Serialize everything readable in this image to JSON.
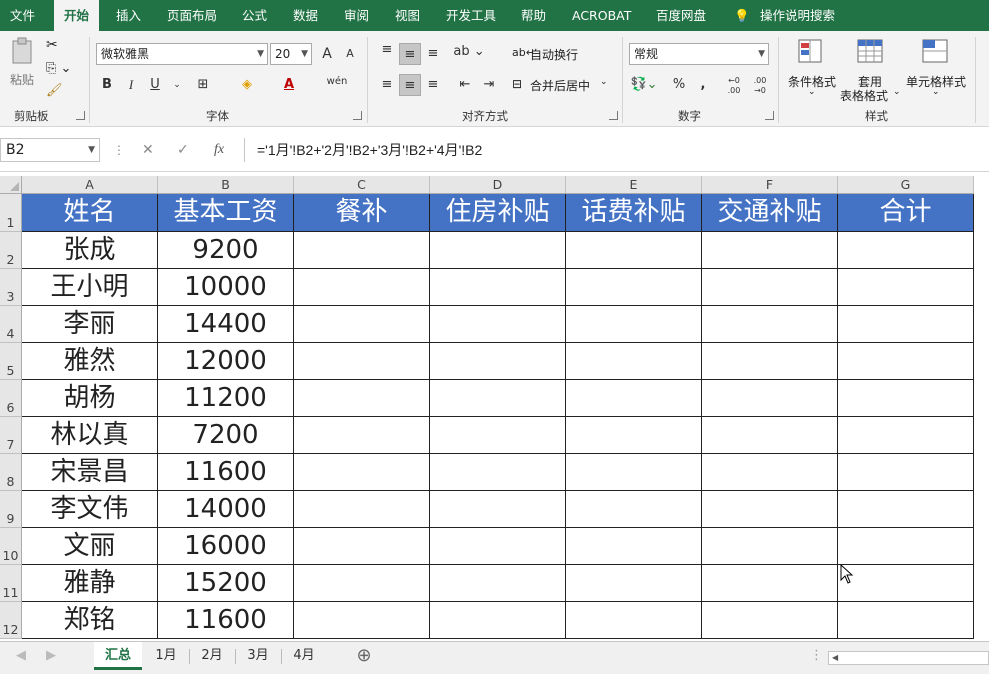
{
  "ribbon_tabs": [
    "文件",
    "开始",
    "插入",
    "页面布局",
    "公式",
    "数据",
    "审阅",
    "视图",
    "开发工具",
    "帮助",
    "ACROBAT",
    "百度网盘",
    "操作说明搜索"
  ],
  "clipboard": {
    "paste": "粘贴",
    "label": "剪贴板"
  },
  "font": {
    "name": "微软雅黑",
    "size": "20",
    "grow": "A",
    "shrink": "A",
    "bold": "B",
    "italic": "I",
    "underline": "U",
    "color_letter": "A",
    "phonetic": "wén",
    "label": "字体"
  },
  "alignment": {
    "wrap_text": "自动换行",
    "merge_center": "合并后居中",
    "label": "对齐方式"
  },
  "number": {
    "format": "常规",
    "percent": "%",
    "comma": ",",
    "inc_decimal": "←0 .00",
    "dec_decimal": ".00 →0",
    "label": "数字"
  },
  "styles": {
    "conditional": "条件格式",
    "table_format_1": "套用",
    "table_format_2": "表格格式",
    "cell_styles": "单元格样式",
    "label": "样式"
  },
  "formula_bar": {
    "name_box": "B2",
    "cancel": "✕",
    "enter": "✓",
    "fx": "fx",
    "formula": "='1月'!B2+'2月'!B2+'3月'!B2+'4月'!B2"
  },
  "columns": [
    "A",
    "B",
    "C",
    "D",
    "E",
    "F",
    "G"
  ],
  "rows": [
    "1",
    "2",
    "3",
    "4",
    "5",
    "6",
    "7",
    "8",
    "9",
    "10",
    "11",
    "12"
  ],
  "table": {
    "headers": [
      "姓名",
      "基本工资",
      "餐补",
      "住房补贴",
      "话费补贴",
      "交通补贴",
      "合计"
    ],
    "data": [
      [
        "张成",
        "9200",
        "",
        "",
        "",
        "",
        ""
      ],
      [
        "王小明",
        "10000",
        "",
        "",
        "",
        "",
        ""
      ],
      [
        "李丽",
        "14400",
        "",
        "",
        "",
        "",
        ""
      ],
      [
        "雅然",
        "12000",
        "",
        "",
        "",
        "",
        ""
      ],
      [
        "胡杨",
        "11200",
        "",
        "",
        "",
        "",
        ""
      ],
      [
        "林以真",
        "7200",
        "",
        "",
        "",
        "",
        ""
      ],
      [
        "宋景昌",
        "11600",
        "",
        "",
        "",
        "",
        ""
      ],
      [
        "李文伟",
        "14000",
        "",
        "",
        "",
        "",
        ""
      ],
      [
        "文丽",
        "16000",
        "",
        "",
        "",
        "",
        ""
      ],
      [
        "雅静",
        "15200",
        "",
        "",
        "",
        "",
        ""
      ],
      [
        "郑铭",
        "11600",
        "",
        "",
        "",
        "",
        ""
      ]
    ]
  },
  "sheets": [
    "汇总",
    "1月",
    "2月",
    "3月",
    "4月"
  ],
  "active_sheet": "汇总",
  "colors": {
    "excel_green": "#217346",
    "header_fill": "#4472c4"
  }
}
